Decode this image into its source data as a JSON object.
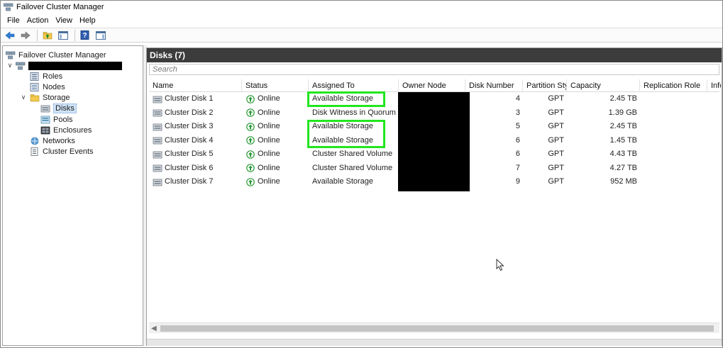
{
  "window": {
    "title": "Failover Cluster Manager"
  },
  "menu": [
    "File",
    "Action",
    "View",
    "Help"
  ],
  "tree": {
    "root": "Failover Cluster Manager",
    "items": {
      "roles": "Roles",
      "nodes": "Nodes",
      "storage": "Storage",
      "disks": "Disks",
      "pools": "Pools",
      "enclosures": "Enclosures",
      "networks": "Networks",
      "cluster_events": "Cluster Events"
    }
  },
  "pane": {
    "title": "Disks (7)",
    "search_placeholder": "Search"
  },
  "columns": [
    "Name",
    "Status",
    "Assigned To",
    "Owner Node",
    "Disk Number",
    "Partition Style",
    "Capacity",
    "Replication Role",
    "Infor"
  ],
  "rows": [
    {
      "name": "Cluster Disk 1",
      "status": "Online",
      "assigned_to": "Available Storage",
      "disk_number": "4",
      "partition_style": "GPT",
      "capacity": "2.45 TB"
    },
    {
      "name": "Cluster Disk 2",
      "status": "Online",
      "assigned_to": "Disk Witness in Quorum",
      "disk_number": "3",
      "partition_style": "GPT",
      "capacity": "1.39 GB"
    },
    {
      "name": "Cluster Disk 3",
      "status": "Online",
      "assigned_to": "Available Storage",
      "disk_number": "5",
      "partition_style": "GPT",
      "capacity": "2.45 TB"
    },
    {
      "name": "Cluster Disk 4",
      "status": "Online",
      "assigned_to": "Available Storage",
      "disk_number": "6",
      "partition_style": "GPT",
      "capacity": "1.45 TB"
    },
    {
      "name": "Cluster Disk 5",
      "status": "Online",
      "assigned_to": "Cluster Shared Volume",
      "disk_number": "6",
      "partition_style": "GPT",
      "capacity": "4.43 TB"
    },
    {
      "name": "Cluster Disk 6",
      "status": "Online",
      "assigned_to": "Cluster Shared Volume",
      "disk_number": "7",
      "partition_style": "GPT",
      "capacity": "4.27 TB"
    },
    {
      "name": "Cluster Disk 7",
      "status": "Online",
      "assigned_to": "Available Storage",
      "disk_number": "9",
      "partition_style": "GPT",
      "capacity": "952 MB"
    }
  ],
  "colors": {
    "highlight": "#22e61e",
    "header_bg": "#3c3c3c",
    "online_green": "#2e9b3a"
  },
  "icons": {
    "back": "back-arrow-icon",
    "forward": "forward-arrow-icon",
    "up": "folder-up-icon",
    "console": "console-tree-icon",
    "help": "help-icon",
    "pane": "action-pane-icon"
  }
}
